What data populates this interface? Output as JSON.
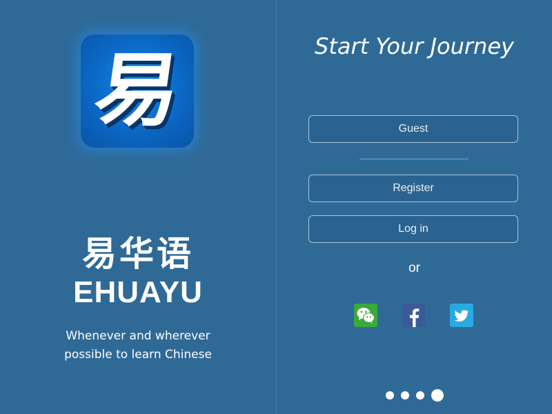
{
  "splash": {
    "app_icon_glyph": "易",
    "brand_cn": "易华语",
    "brand_en": "EHUAYU",
    "tagline_line1": "Whenever and wherever",
    "tagline_line2": "possible to learn Chinese"
  },
  "start": {
    "title": "Start Your Journey",
    "guest_label": "Guest",
    "register_label": "Register",
    "login_label": "Log in",
    "or_label": "or",
    "social": [
      {
        "icon": "wechat-icon",
        "color": "#3aaa3a"
      },
      {
        "icon": "facebook-icon",
        "color": "#3b5b98"
      },
      {
        "icon": "twitter-icon",
        "color": "#2aa9e0"
      }
    ],
    "page_indicator": {
      "count": 4,
      "active_index": 3
    }
  },
  "colors": {
    "background": "#2f6a97",
    "button_fill": "#2b6390",
    "button_border": "#a9c6dd",
    "icon_blue": "#0b67c5"
  }
}
